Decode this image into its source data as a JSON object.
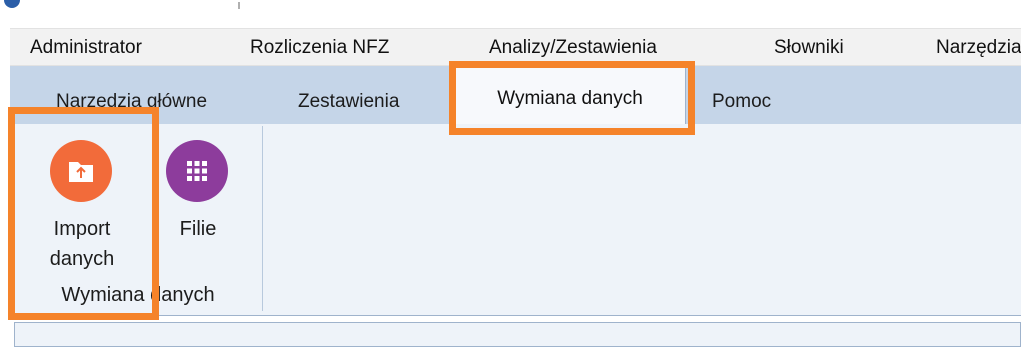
{
  "menu": {
    "items": [
      "Administrator",
      "Rozliczenia NFZ",
      "Analizy/Zestawienia",
      "Słowniki",
      "Narzędzia"
    ]
  },
  "ribbon": {
    "tabs": {
      "main_tools": "Narzędzia główne",
      "reports": "Zestawienia",
      "data_exchange": "Wymiana danych",
      "help": "Pomoc"
    },
    "active_tab": "Wymiana danych",
    "groups": {
      "data_exchange": {
        "label": "Wymiana danych",
        "buttons": {
          "import": {
            "line1": "Import",
            "line2": "danych",
            "icon": "folder-upload-icon",
            "color": "#f26b3a"
          },
          "branches": {
            "label": "Filie",
            "icon": "grid-icon",
            "color": "#8d3c9c"
          }
        }
      }
    }
  },
  "colors": {
    "highlight": "#f5832a",
    "ribbon_bg": "#eef3f9",
    "tabstrip_bg": "#c5d5e8"
  }
}
